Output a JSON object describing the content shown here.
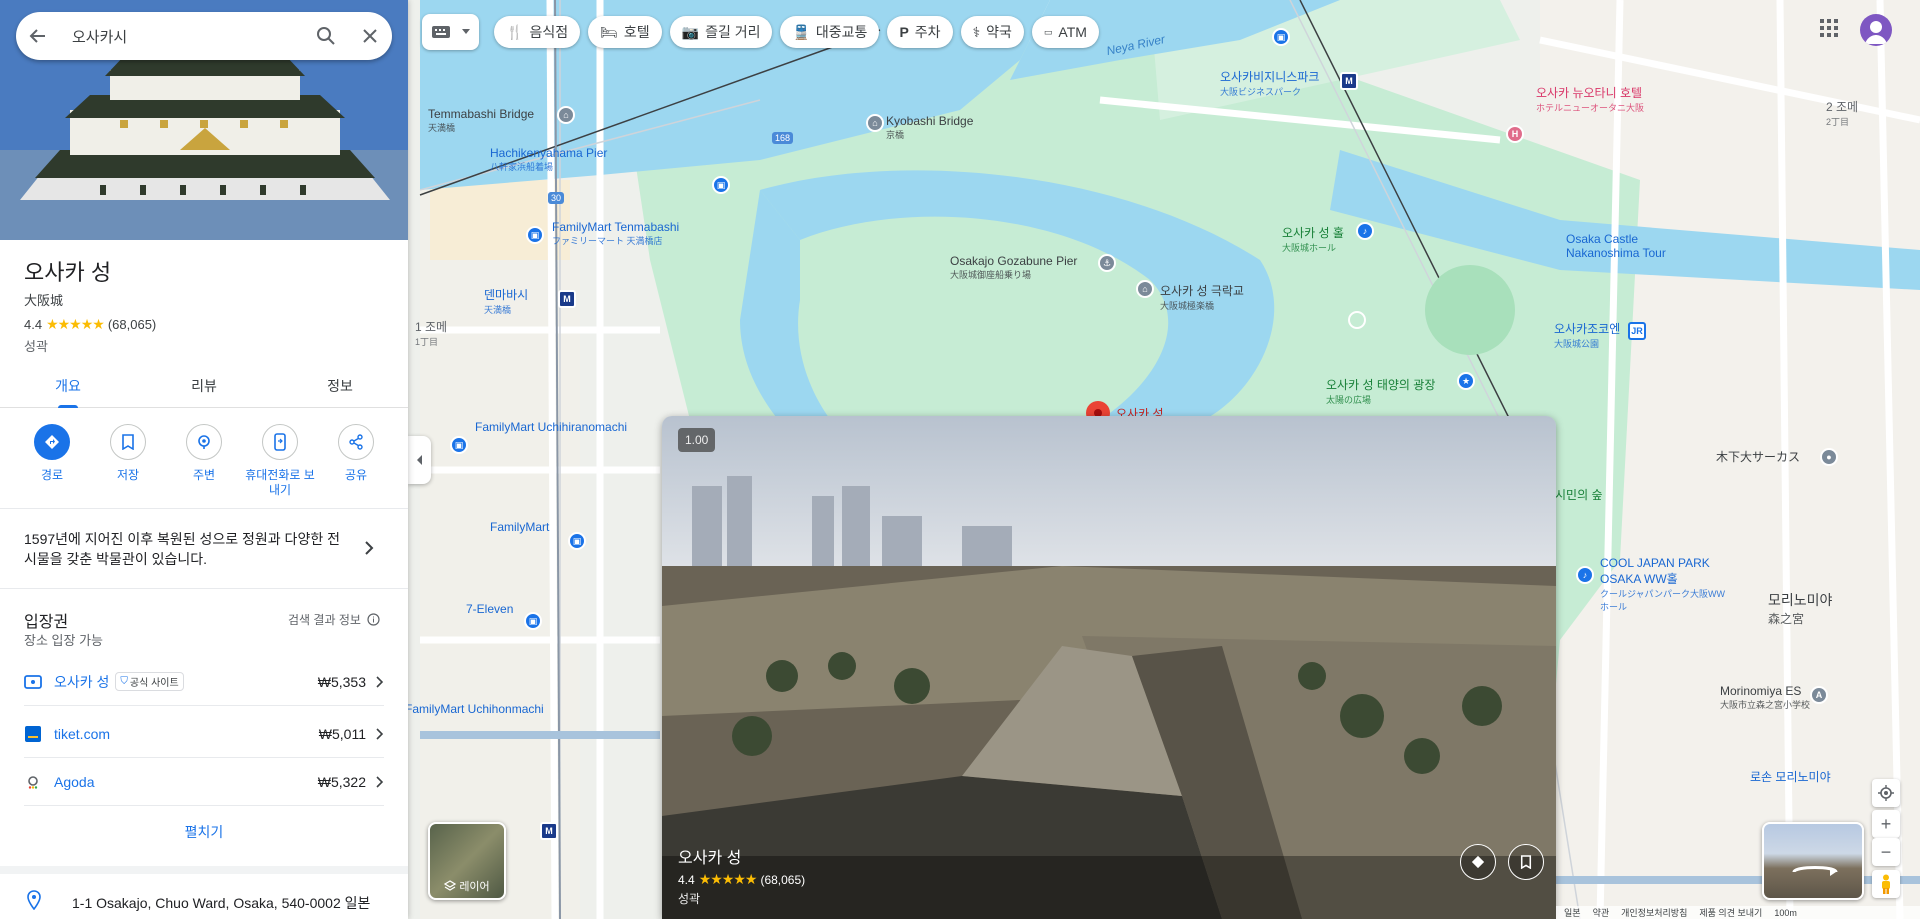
{
  "search": {
    "query": "오사카시"
  },
  "place": {
    "title": "오사카 성",
    "subtitle": "大阪城",
    "rating": "4.4",
    "stars": "★★★★★",
    "reviews": "(68,065)",
    "category": "성곽",
    "description": "1597년에 지어진 이후 복원된 성으로 정원과 다양한 전시물을 갖춘 박물관이 있습니다.",
    "address": "1-1 Osakajo, Chuo Ward, Osaka, 540-0002 일본"
  },
  "tabs": [
    {
      "label": "개요"
    },
    {
      "label": "리뷰"
    },
    {
      "label": "정보"
    }
  ],
  "actions": [
    {
      "label": "경로",
      "icon": "directions-icon"
    },
    {
      "label": "저장",
      "icon": "bookmark-icon"
    },
    {
      "label": "주변",
      "icon": "nearby-icon"
    },
    {
      "label": "휴대전화로 보내기",
      "icon": "send-to-phone-icon"
    },
    {
      "label": "공유",
      "icon": "share-icon"
    }
  ],
  "tickets": {
    "title": "입장권",
    "subtitle": "장소 입장 가능",
    "meta": "검색 결과 정보",
    "rows": [
      {
        "name": "오사카 성",
        "badge": "공식 사이트",
        "price": "₩5,353"
      },
      {
        "name": "tiket.com",
        "price": "₩5,011"
      },
      {
        "name": "Agoda",
        "price": "₩5,322"
      }
    ],
    "expand": "펼치기"
  },
  "chips": [
    {
      "label": "음식점",
      "icon": "restaurant-icon"
    },
    {
      "label": "호텔",
      "icon": "hotel-icon"
    },
    {
      "label": "즐길 거리",
      "icon": "camera-icon"
    },
    {
      "label": "대중교통",
      "icon": "transit-icon"
    },
    {
      "label": "주차",
      "icon": "parking-icon"
    },
    {
      "label": "약국",
      "icon": "pharmacy-icon"
    },
    {
      "label": "ATM",
      "icon": "atm-icon"
    }
  ],
  "preview": {
    "speed": "1.00",
    "title": "오사카 성",
    "rating": "4.4",
    "stars": "★★★★★",
    "reviews": "(68,065)",
    "category": "성곽"
  },
  "layers": {
    "label": "레이어"
  },
  "footer": {
    "items": [
      "일본",
      "약관",
      "개인정보처리방침",
      "제품 의견 보내기"
    ],
    "scale": "100m"
  },
  "map_labels": {
    "temmabashi": "Temmabashi Bridge",
    "temmabashi_sub": "天満橋",
    "hachiken": "Hachikenyahama Pier",
    "hachiken_sub": "八軒家浜船着場",
    "kyobashi": "Kyobashi Bridge",
    "kyobashi_sub": "京橋",
    "neya": "Neya River",
    "familymart1": "FamilyMart Tenmabashi",
    "familymart1_sub": "ファミリーマート 天満橋店",
    "gozabune": "Osakajo Gozabune Pier",
    "gozabune_sub": "大阪城御座船乗り場",
    "gokuraku": "오사카 성 극락교",
    "gokuraku_sub": "大阪城極楽橋",
    "castle_pin": "오사카 성",
    "business_park": "오사카비지니스파크",
    "business_park_sub": "大阪ビジネスパーク",
    "newotani": "오사카 뉴오타니 호텔",
    "newotani_sub": "ホテルニューオータニ大阪",
    "castle_hall": "오사카 성 홀",
    "castle_hall_sub": "大阪城ホール",
    "nakanoshima": "Osaka Castle Nakanoshima Tour",
    "osakajo_koen": "오사카조코엔",
    "osakajo_koen_sub": "大阪城公園",
    "taiyo": "오사카 성 태양의 광장",
    "taiyo_sub": "太陽の広場",
    "kinoshita": "木下大サーカス",
    "cool_japan": "COOL JAPAN PARK OSAKA WW홀",
    "cool_japan_sub": "クールジャパンパーク大阪WWホール",
    "morinomiya": "모리노미야",
    "morinomiya_sub": "森之宮",
    "morinomiya_es": "Morinomiya ES",
    "morinomiya_es_sub": "大阪市立森之宮小学校",
    "lotus": "로손 모리노미야",
    "tenmabashi_station": "덴마바시",
    "tenmabashi_station_sub": "天満橋",
    "familymart2": "FamilyMart Uchihiranomachi",
    "familymart3": "FamilyMart",
    "seven": "7-Eleven",
    "familymart4": "FamilyMart Uchihonmachi",
    "forest": "시민의 숲",
    "chome1": "1 조메",
    "chome1_sub": "1丁目",
    "chome2": "2 조메",
    "chome2_sub": "2丁目",
    "road_sign": "168",
    "route30": "30"
  },
  "colors": {
    "accent": "#1a73e8",
    "water": "#9cd7f0",
    "park": "#c6ecd4",
    "road": "#ffffff",
    "pin_red": "#ea4335"
  }
}
